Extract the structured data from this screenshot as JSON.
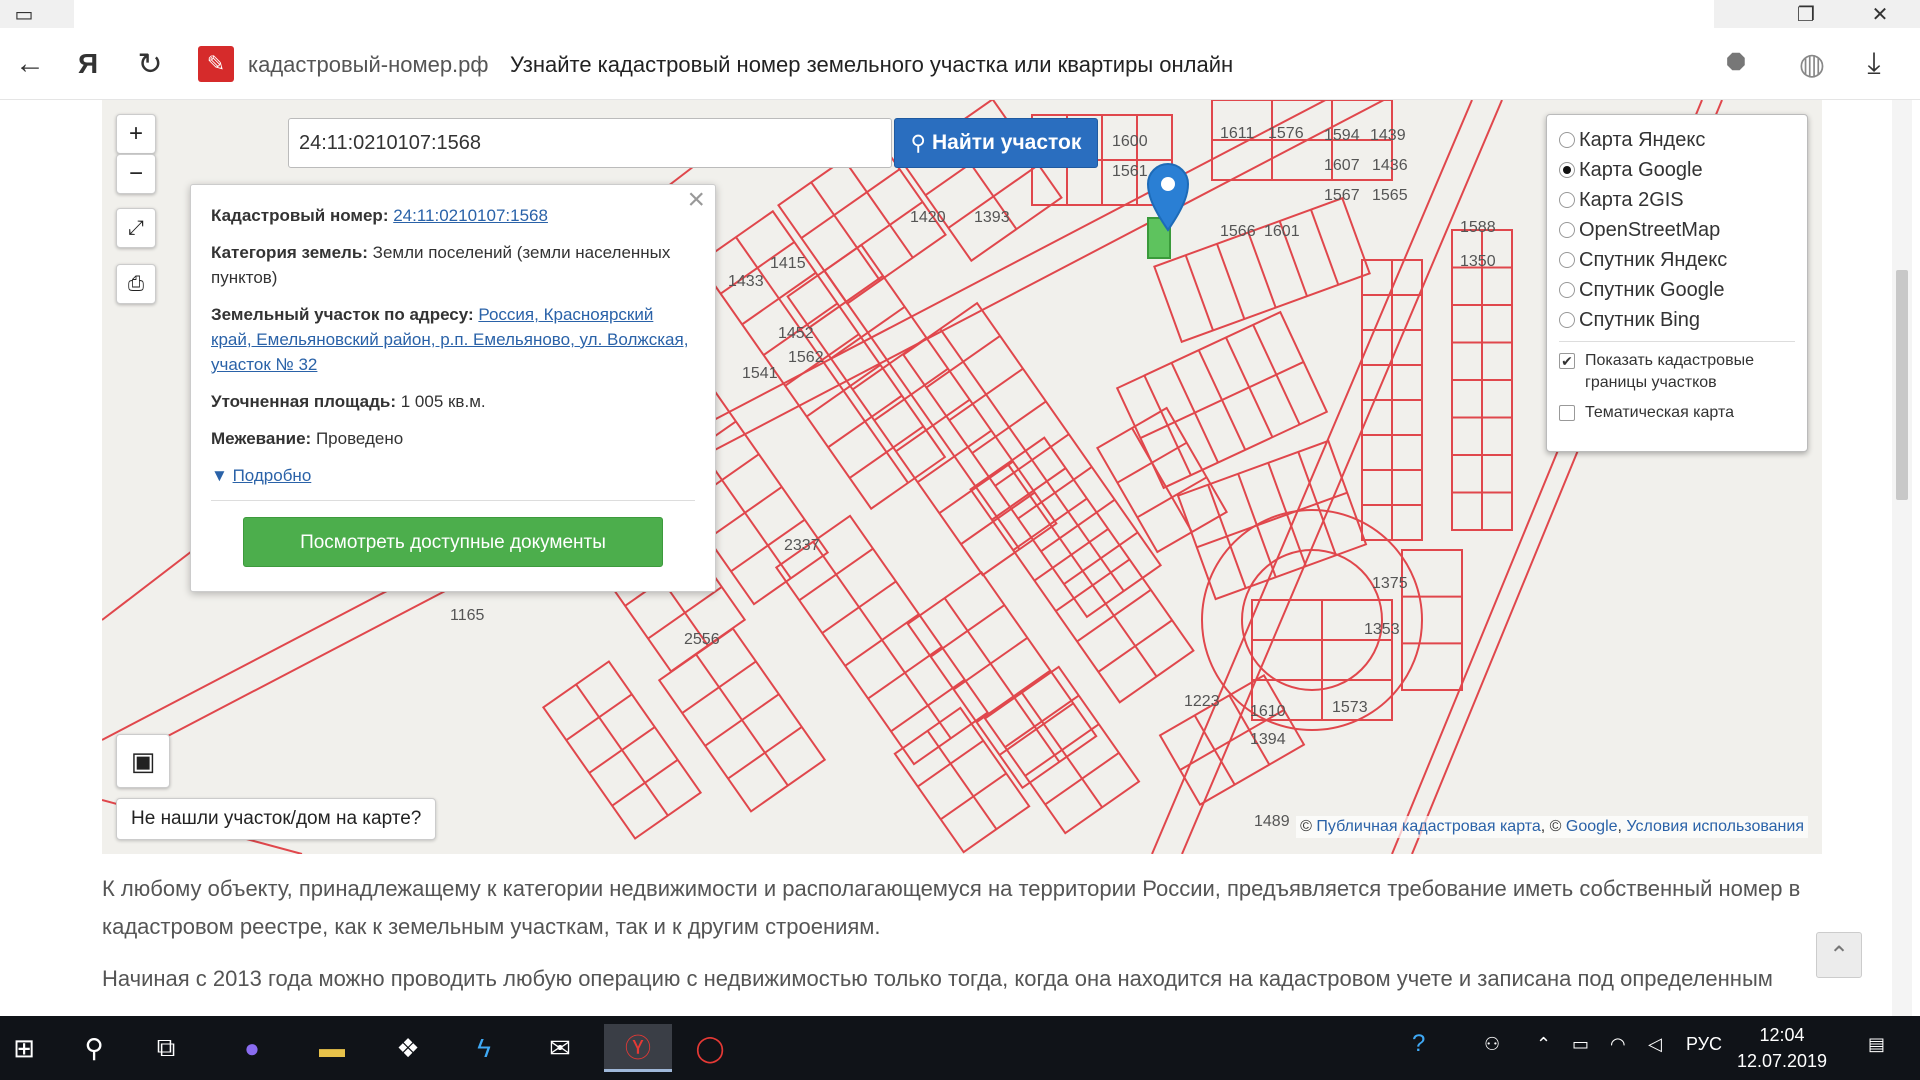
{
  "browser": {
    "domain": "кадастровый-номер.рф",
    "page_title": "Узнайте кадастровый номер земельного участка или квартиры онлайн"
  },
  "search": {
    "value": "24:11:0210107:1568",
    "button_label": "Найти участок"
  },
  "popup": {
    "cad_label": "Кадастровый номер:",
    "cad_value": "24:11:0210107:1568",
    "category_label": "Категория земель:",
    "category_value": "Земли поселений (земли населенных пунктов)",
    "address_label": "Земельный участок по адресу:",
    "address_value": "Россия, Красноярский край, Емельяновский район, р.п. Емельяново, ул. Волжская, участок № 32",
    "area_label": "Уточненная площадь:",
    "area_value": "1 005 кв.м.",
    "survey_label": "Межевание:",
    "survey_value": "Проведено",
    "details_link": "Подробно",
    "docs_button": "Посмотреть доступные документы"
  },
  "layers": {
    "options": [
      "Карта Яндекс",
      "Карта Google",
      "Карта 2GIS",
      "OpenStreetMap",
      "Спутник Яндекс",
      "Спутник Google",
      "Спутник Bing"
    ],
    "selected": "Карта Google",
    "show_borders": "Показать кадастровые границы участков",
    "thematic": "Тематическая карта"
  },
  "map": {
    "not_found": "Не нашли участок/дом на карте?",
    "attrib_prefix": "©",
    "attrib_pkk": "Публичная кадастровая карта",
    "attrib_sep": ", ©",
    "attrib_google": "Google",
    "attrib_terms": "Условия использования",
    "parcel_labels": [
      "1165",
      "2337",
      "1566",
      "1601",
      "1588",
      "1350",
      "1600",
      "1561",
      "1611",
      "1576",
      "1594",
      "1439",
      "1607",
      "1436",
      "1567",
      "1565",
      "1420",
      "1393",
      "1433",
      "1415",
      "1452",
      "1541",
      "1562",
      "2556",
      "1610",
      "1394",
      "1223",
      "1489",
      "1573",
      "1375",
      "1353"
    ],
    "marker_color": "#2a7fd4",
    "selected_parcel_color": "#5ec35e",
    "boundary_color": "#e0474c"
  },
  "article": {
    "p1": "К любому объекту, принадлежащему к категории недвижимости и располагающемуся на территории России, предъявляется требование иметь собственный номер в кадастровом реестре, как к земельным участкам, так и к другим строениям.",
    "p2": "Начиная с 2013 года можно проводить любую операцию с недвижимостью только тогда, когда она находится на кадастровом учете и записана под определенным"
  },
  "taskbar": {
    "language": "РУС",
    "time": "12:04",
    "date": "12.07.2019"
  }
}
